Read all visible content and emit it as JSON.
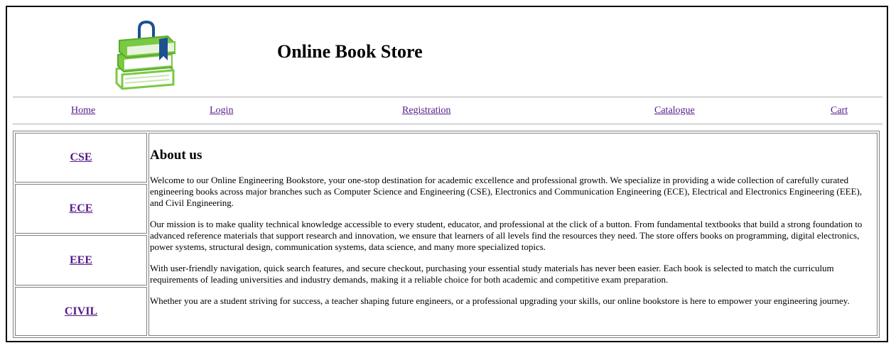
{
  "header": {
    "title": "Online Book Store",
    "logo_icon": "books-stack-icon"
  },
  "nav": {
    "items": [
      {
        "label": "Home"
      },
      {
        "label": "Login"
      },
      {
        "label": "Registration"
      },
      {
        "label": "Catalogue"
      },
      {
        "label": "Cart"
      }
    ]
  },
  "branches": [
    {
      "label": "CSE"
    },
    {
      "label": "ECE"
    },
    {
      "label": "EEE"
    },
    {
      "label": "CIVIL"
    }
  ],
  "about": {
    "title": "About us",
    "paragraphs": [
      "Welcome to our Online Engineering Bookstore, your one-stop destination for academic excellence and professional growth. We specialize in providing a wide collection of carefully curated engineering books across major branches such as Computer Science and Engineering (CSE), Electronics and Communication Engineering (ECE), Electrical and Electronics Engineering (EEE), and Civil Engineering.",
      "Our mission is to make quality technical knowledge accessible to every student, educator, and professional at the click of a button. From fundamental textbooks that build a strong foundation to advanced reference materials that support research and innovation, we ensure that learners of all levels find the resources they need. The store offers books on programming, digital electronics, power systems, structural design, communication systems, data science, and many more specialized topics.",
      "With user-friendly navigation, quick search features, and secure checkout, purchasing your essential study materials has never been easier. Each book is selected to match the curriculum requirements of leading universities and industry demands, making it a reliable choice for both academic and competitive exam preparation.",
      "Whether you are a student striving for success, a teacher shaping future engineers, or a professional upgrading your skills, our online bookstore is here to empower your engineering journey."
    ]
  },
  "colors": {
    "link": "#551a8b",
    "logo_green": "#7ac943",
    "logo_blue": "#1d4f91"
  }
}
